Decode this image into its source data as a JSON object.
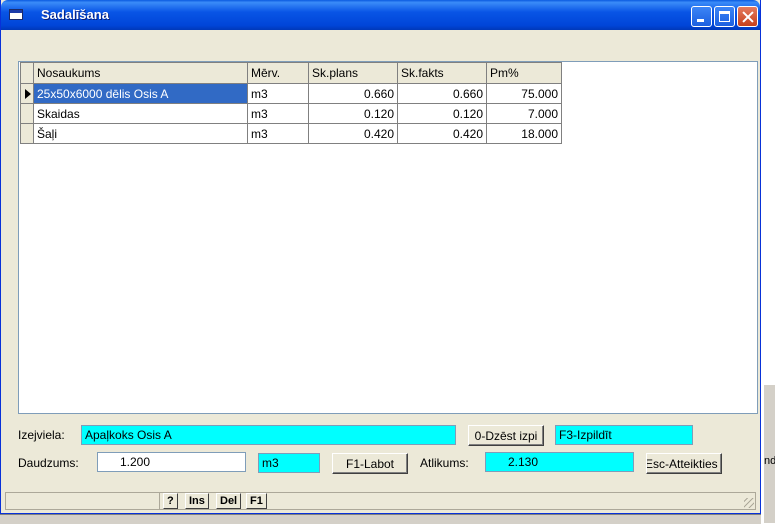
{
  "window": {
    "title": "Sadalīšana"
  },
  "grid": {
    "columns": [
      "Nosaukums",
      "Mērv.",
      "Sk.plans",
      "Sk.fakts",
      "Pm%"
    ],
    "rows": [
      [
        "25x50x6000 dēlis Osis A",
        "m3",
        "0.660",
        "0.660",
        "75.000"
      ],
      [
        "Skaidas",
        "m3",
        "0.120",
        "0.120",
        "7.000"
      ],
      [
        "Šaļi",
        "m3",
        "0.420",
        "0.420",
        "18.000"
      ]
    ],
    "selected_row": 0
  },
  "form": {
    "izejviela_label": "Izejviela:",
    "izejviela_value": "Apaļkoks Osis A",
    "dzest_button": "0-Dzēst izpi",
    "izpildit_value": "F3-Izpildīt",
    "daudzums_label": "Daudzums:",
    "daudzums_value": "1.200",
    "unit_value": "m3",
    "labot_button": "F1-Labot",
    "atlikums_label": "Atlikums:",
    "atlikums_value": "2.130",
    "atteikties_button": "Esc-Atteikties"
  },
  "statusbar": {
    "keys": [
      "?",
      "Ins",
      "Del",
      "F1"
    ]
  },
  "background": {
    "fragment_text": "nd"
  },
  "colors": {
    "title_bar": "#0a5ae0",
    "highlight_fields": "#00ffff",
    "selection": "#316ac5"
  }
}
